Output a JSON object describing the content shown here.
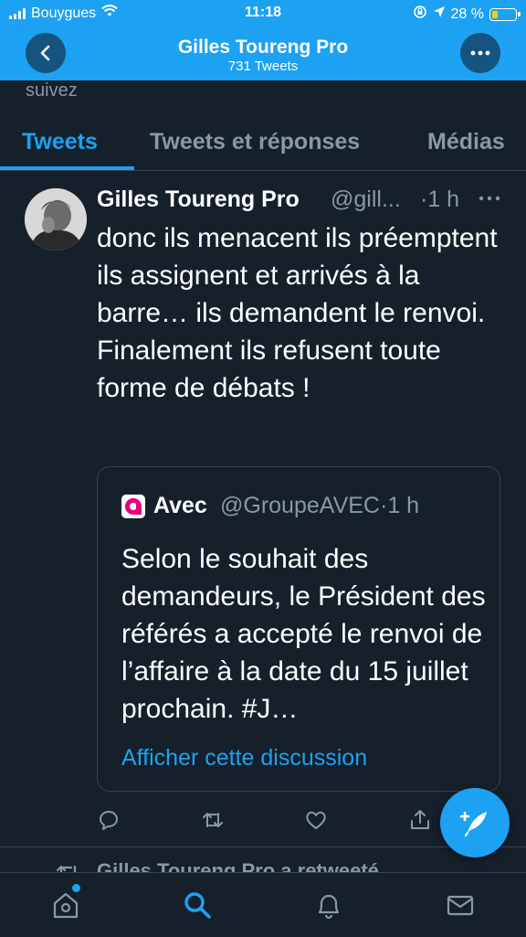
{
  "status_bar": {
    "carrier": "Bouygues",
    "time": "11:18",
    "battery": "28 %",
    "battery_level": 0.28,
    "battery_color": "#ffcc00"
  },
  "header": {
    "title": "Gilles Toureng Pro",
    "subtitle": "731 Tweets"
  },
  "profile_snippet": "suivez",
  "tabs": [
    {
      "label": "Tweets",
      "active": true
    },
    {
      "label": "Tweets et réponses",
      "active": false
    },
    {
      "label": "Médias",
      "active": false
    }
  ],
  "tweet": {
    "author_name": "Gilles Toureng Pro",
    "author_handle": "@gill...",
    "time": "·1 h",
    "text": "donc ils menacent ils préemptent ils assignent et arrivés à la barre… ils demandent le renvoi. Finalement ils refusent toute forme de débats !",
    "quoted": {
      "author_name": "Avec",
      "author_handle": "@GroupeAVEC·1 h",
      "text": "Selon le souhait des demandeurs, le Président des référés a accepté le renvoi de l’affaire à la date du 15 juillet prochain. #J…",
      "link": "Afficher cette discussion"
    }
  },
  "next_item": {
    "retweet_text": "Gilles Toureng Pro a retweeté"
  },
  "colors": {
    "accent": "#1da1f2",
    "background": "#15202b",
    "muted": "#8899a6",
    "border": "#38444d"
  },
  "icons": [
    "back-arrow-icon",
    "more-dots-icon",
    "reply-icon",
    "retweet-icon",
    "like-icon",
    "share-icon",
    "compose-feather-icon",
    "home-icon",
    "search-icon",
    "notifications-bell-icon",
    "messages-envelope-icon"
  ]
}
